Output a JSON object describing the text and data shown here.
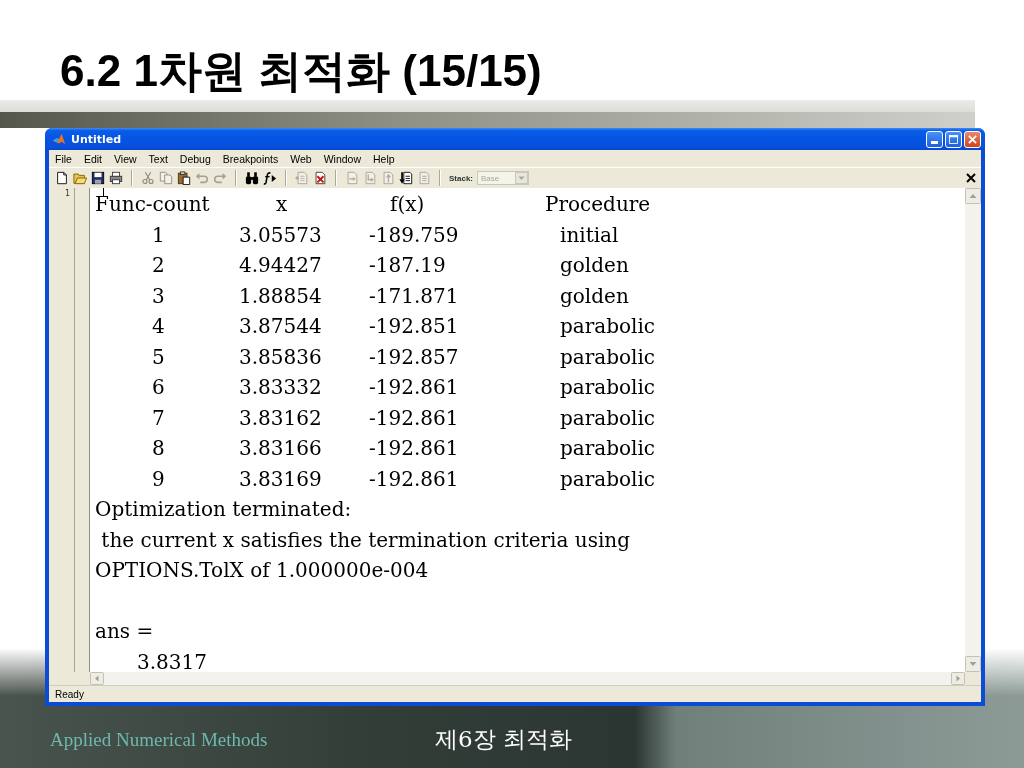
{
  "slide": {
    "title": "6.2 1차원 최적화 (15/15)"
  },
  "window": {
    "title": "Untitled",
    "menu": [
      "File",
      "Edit",
      "View",
      "Text",
      "Debug",
      "Breakpoints",
      "Web",
      "Window",
      "Help"
    ],
    "toolbar": {
      "groups": [
        [
          {
            "kind": "new",
            "disabled": false
          },
          {
            "kind": "open",
            "disabled": false
          },
          {
            "kind": "save",
            "disabled": false
          },
          {
            "kind": "print",
            "disabled": false
          }
        ],
        [
          {
            "kind": "cut",
            "disabled": true
          },
          {
            "kind": "copy",
            "disabled": true
          },
          {
            "kind": "paste",
            "disabled": false
          },
          {
            "kind": "undo",
            "disabled": true
          },
          {
            "kind": "redo",
            "disabled": true
          }
        ],
        [
          {
            "kind": "find",
            "disabled": false
          },
          {
            "kind": "function",
            "disabled": false
          }
        ],
        [
          {
            "kind": "clear_breakpoint",
            "disabled": true
          },
          {
            "kind": "clear_all_breakpoints",
            "disabled": false
          }
        ],
        [
          {
            "kind": "step",
            "disabled": true
          },
          {
            "kind": "step_in",
            "disabled": true
          },
          {
            "kind": "step_out",
            "disabled": true
          },
          {
            "kind": "continue",
            "disabled": false
          },
          {
            "kind": "exit_debug",
            "disabled": true
          }
        ]
      ],
      "stack": {
        "label": "Stack:",
        "value": "Base",
        "disabled": true
      }
    },
    "editor": {
      "line_numbers": [
        "1"
      ],
      "table": {
        "columns": [
          "Func-count",
          "x",
          "f(x)",
          "Procedure"
        ],
        "rows": [
          [
            "1",
            "3.05573",
            "-189.759",
            "initial"
          ],
          [
            "2",
            "4.94427",
            "-187.19",
            "golden"
          ],
          [
            "3",
            "1.88854",
            "-171.871",
            "golden"
          ],
          [
            "4",
            "3.87544",
            "-192.851",
            "parabolic"
          ],
          [
            "5",
            "3.85836",
            "-192.857",
            "parabolic"
          ],
          [
            "6",
            "3.83332",
            "-192.861",
            "parabolic"
          ],
          [
            "7",
            "3.83162",
            "-192.861",
            "parabolic"
          ],
          [
            "8",
            "3.83166",
            "-192.861",
            "parabolic"
          ],
          [
            "9",
            "3.83169",
            "-192.861",
            "parabolic"
          ]
        ]
      },
      "message": [
        "Optimization terminated:",
        " the current x satisfies the termination criteria using",
        "OPTIONS.TolX of 1.000000e-004"
      ],
      "answer": {
        "label": "ans =",
        "value": "3.8317"
      }
    },
    "status_bar": {
      "text": "Ready"
    }
  },
  "footer": {
    "course": "Applied Numerical Methods",
    "chapter": "제6장 최적화"
  }
}
